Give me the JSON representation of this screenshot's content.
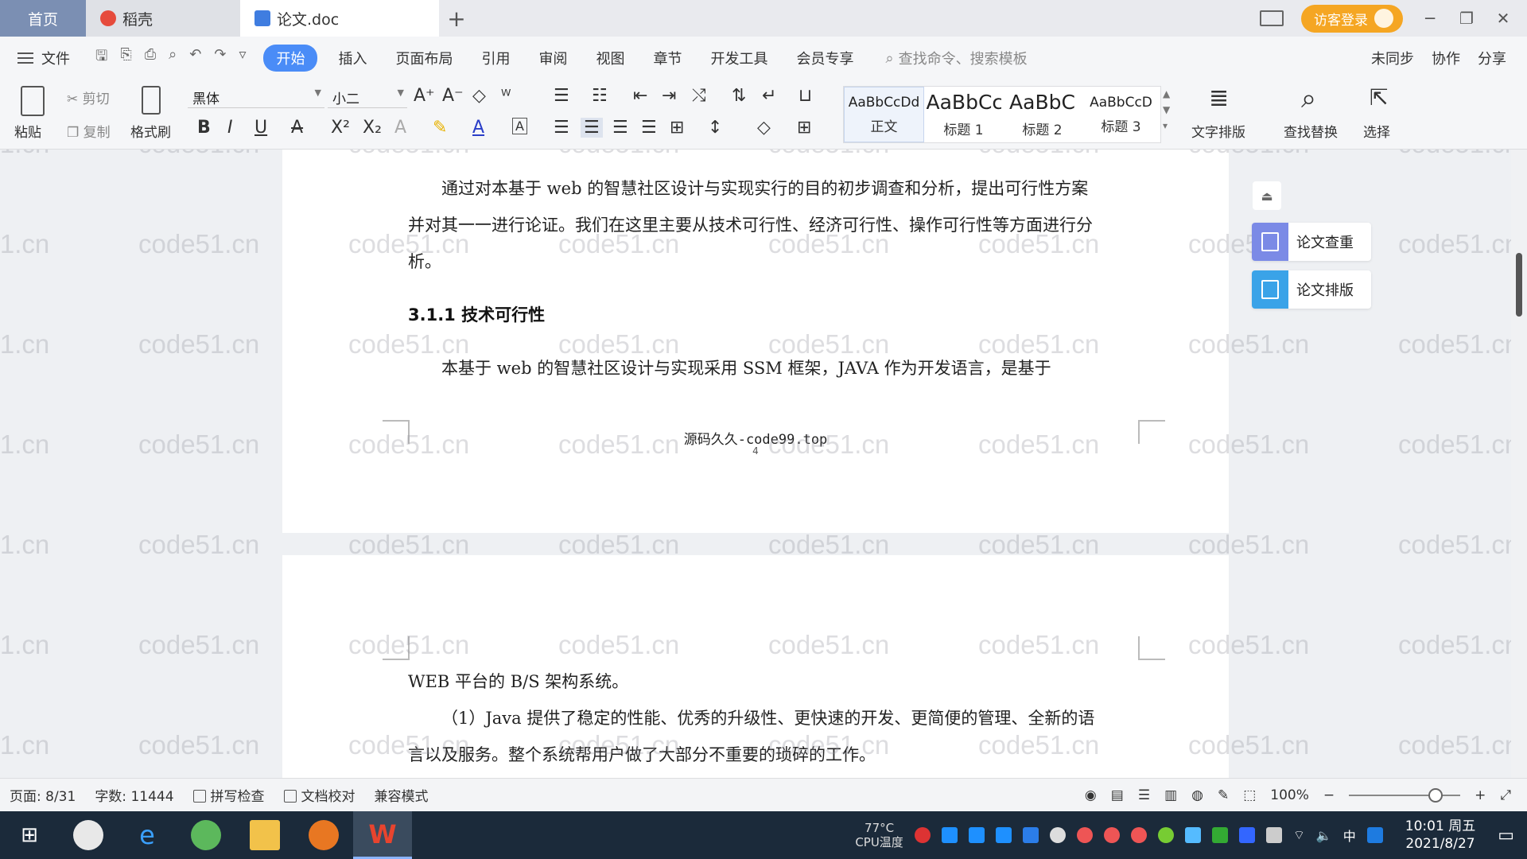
{
  "tabs": {
    "home": "首页",
    "daoke": "稻壳",
    "doc": "论文.doc"
  },
  "titlebar": {
    "visitor_login": "访客登录"
  },
  "menu": {
    "file": "文件",
    "items": [
      "开始",
      "插入",
      "页面布局",
      "引用",
      "审阅",
      "视图",
      "章节",
      "开发工具",
      "会员专享"
    ],
    "active": "开始",
    "search_placeholder": "查找命令、搜索模板",
    "right": [
      "未同步",
      "协作",
      "分享"
    ]
  },
  "ribbon": {
    "paste": "粘贴",
    "cut": "剪切",
    "copy": "复制",
    "format_painter": "格式刷",
    "font_name": "黑体",
    "font_size": "小二",
    "styles": [
      {
        "preview": "AaBbCcDd",
        "name": "正文"
      },
      {
        "preview": "AaBbCc",
        "name": "标题 1"
      },
      {
        "preview": "AaBbC",
        "name": "标题 2"
      },
      {
        "preview": "AaBbCcD",
        "name": "标题 3"
      }
    ],
    "text_layout": "文字排版",
    "find_replace": "查找替换",
    "select": "选择"
  },
  "document": {
    "para1": "通过对本基于 web 的智慧社区设计与实现实行的目的初步调查和分析，提出可行性方案并对其一一进行论证。我们在这里主要从技术可行性、经济可行性、操作可行性等方面进行分析。",
    "heading": "3.1.1 技术可行性",
    "para2": "本基于 web 的智慧社区设计与实现采用 SSM 框架，JAVA 作为开发语言，是基于",
    "footer": "源码久久-code99.top",
    "page_number": "4",
    "para3": "WEB 平台的 B/S 架构系统。",
    "para4": "（1）Java 提供了稳定的性能、优秀的升级性、更快速的开发、更简便的管理、全新的语言以及服务。整个系统帮用户做了大部分不重要的琐碎的工作。",
    "watermark": "code51.cn"
  },
  "side_panel": {
    "check": "论文查重",
    "layout": "论文排版"
  },
  "status": {
    "page": "页面: 8/31",
    "words": "字数: 11444",
    "spell_check": "拼写检查",
    "doc_proof": "文档校对",
    "compat": "兼容模式",
    "zoom": "100%"
  },
  "taskbar": {
    "temp": "77°C",
    "temp_label": "CPU温度",
    "ime": "中",
    "time": "10:01 周五",
    "date": "2021/8/27"
  },
  "colors": {
    "accent": "#4a8cf7",
    "home_tab": "#7b8fb3",
    "visitor": "#f5a623"
  }
}
